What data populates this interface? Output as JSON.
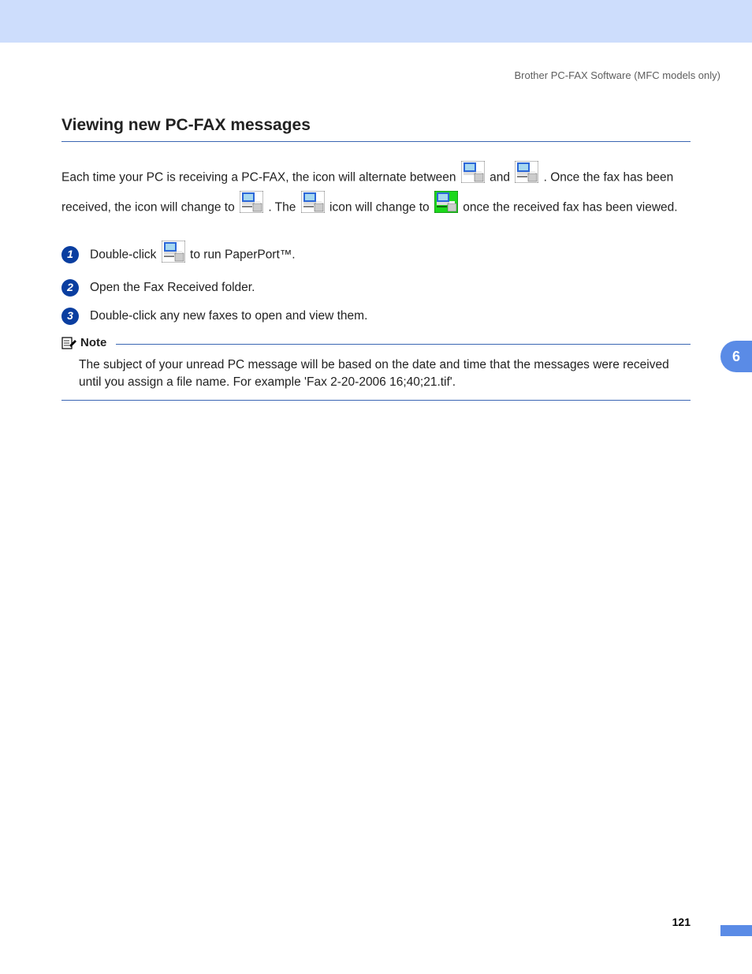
{
  "header": "Brother PC-FAX Software (MFC models only)",
  "section_title": "Viewing new PC-FAX messages",
  "intro": {
    "t1": "Each time your PC is receiving a PC-FAX, the icon will alternate between ",
    "t2": " and ",
    "t3": ". Once the fax has been received, the icon will change to ",
    "t4": ". The ",
    "t5": " icon will change to ",
    "t6": " once the received fax has been viewed."
  },
  "steps": {
    "s1a": "Double-click ",
    "s1b": " to run PaperPort™.",
    "s2": "Open the Fax Received folder.",
    "s3": "Double-click any new faxes to open and view them."
  },
  "note_label": "Note",
  "note_text": "The subject of your unread PC message will be based on the date and time that the messages were received until you assign a file name. For example 'Fax 2-20-2006 16;40;21.tif'.",
  "chapter_number": "6",
  "page_number": "121",
  "icons": {
    "fax_blue_bg": "#2b67d8",
    "fax_green_bg": "#1dd81d",
    "fax_plain_bg": "#dcdcdc"
  }
}
